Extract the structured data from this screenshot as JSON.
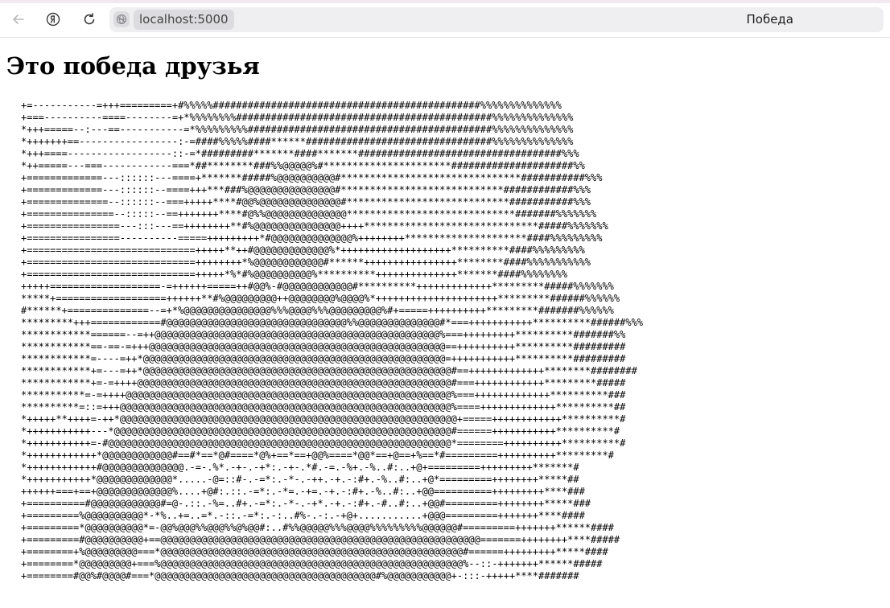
{
  "browser": {
    "url": "localhost:5000",
    "tab_title": "Победа"
  },
  "page": {
    "heading": "Это победа друзья",
    "ascii_art": "+=-----------=+++=========+#%%%%%##############################################%%%%%%%%%%%%%%\n+===----------====--------=+*%%%%%%%%############################################%%%%%%%%%%%%%%\n*+++=====--:---==-----------=*%%%%%%%%%##########################################%%%%%%%%%%%%%%\n*+++++++==-----------------:-=####%%%%%####******################################%%%%%%%%%%%%%%\n*+++====------------------::-=*#########*******####*******###################################%%%\n*++=====---===------------===*##********###%%@@@@@%#**********************#####################%%\n+=============---::::::---====+*******#####%@@@@@@@@@@#*******************************###########%%%\n+=============---::::::--====+++***###%@@@@@@@@@@@@@@@#****************************############%%%\n+==============--::::::--===+++++****#@@%@@@@@@@@@@@@@@#****************************###########%%%\n+===============--:::::--==+++++++****#@%%@@@@@@@@@@@@@@*****************************#######%%%%%%%\n+================---:::---==++++++++**#%@@@@@@@@@@@@@@@++++******************************#####%%%%%%%\n+================----------=====+++++++++*#@@@@@@@@@@@@@@%++++++++*********************####%%%%%%%%%\n+=============================+++++**++#@@@@@@@@@@@@@%*+++++++++++++++++++**********####%%%%%%%%%\n+=============================++++++++*%@@@@@@@@@@@@#******++++++++++++++++********####%%%%%%%%%%%\n+=============================+++++*%*#%@@@@@@@@@@%**********++++++++++++++*******####%%%%%%%%\n+++++===================-=++++++=====++#@@%-#@@@@@@@@@@@@#**********+++++++++++++*********#####%%%%%%%\n*****+===================++++++**#%@@@@@@@@@++@@@@@@@@%@@@@%*+++++++++++++++++++++*********######%%%%%%\n#******+==============--=+*%@@@@@@@@@@@@@@@%%%@@@@%%%@@@@@@@@@%#+=====++++++++++*********#######%%%%%%\n*********+++============#@@@@@@@@@@@@@@@@@@@@@@@@@@@@@@@%%@@@@@@@@@@@@@@#*===+++++++++++**********######%%%\n************======--=++@@@@@@@@@@@@@@@@@@@@@@@@@@@@@@@@@@@@@@@@@@@@@@@@@%===+++++++++**********#######%%\n************==-==-=+++@@@@@@@@@@@@@@@@@@@@@@@@@@@@@@@@@@@@@@@@@@@@@@@@@@@==++++++++++**********#########\n************=----=++*@@@@@@@@@@@@@@@@@@@@@@@@@@@@@@@@@@@@@@@@@@@@@@@@@@@@=+++++++++++**********#########\n************+=---=++*@@@@@@@@@@@@@@@@@@@@@@@@@@@@@@@@@@@@@@@@@@@@@@@@@@@@@#==+++++++++++++********########\n************+=-=++++@@@@@@@@@@@@@@@@@@@@@@@@@@@@@@@@@@@@@@@@@@@@@@@@@@@@@@#===++++++++++++*********#####\n***********=-=++++@@@@@@@@@@@@@@@@@@@@@@@@@@@@@@@@@@@@@@@@@@@@@@@@@@@@@@@@%===+++++++++++++**********###\n**********=::=+++@@@@@@@@@@@@@@@@@@@@@@@@@@@@@@@@@@@@@@@@@@@@@@@@@@@@@@@@@%====+++++++++++++**********##\n*+++++**++++=-++*@@@@@@@@@@@@@@@@@@@@@@@@@@@@@@@@@@@@@@@@@@@@@@@@@@@@@@@@@@+=====++++++++++++**********#\n*+++++++++++---*@@@@@@@@@@@@@@@@@@@@@@@@@@@@@@@@@@@@@@@@@@@@@@@@@@@@@@@@@@#======+++++++++++**********#\n*+++++++++++=-#@@@@@@@@@@@@@@@@@@@@@@@@@@@@@@@@@@@@@@@@@@@@@@@@@@@@@@@@@@@*========++++++++++**********#\n*++++++++++++*@@@@@@@@@@@@#==#*==*@#====*@%+==*==+@@%====*@@*==+@==+%==*#=========++++++++++*********#\n*++++++++++++#@@@@@@@@@@@@@@.-=-.%*.-+-.-+*:.-+-.*#.-=.-%+.-%..#:..+@+=========+++++++++*******#\n*+++++++++++*@@@@@@@@@@@@@*.....-@=::#-.-=*:.-*-.-++.-+.-:#+.-%..#:..+@*=========++++++++*****##\n++++++===+==+@@@@@@@@@@@@@%....+@#:.::.-=*:.-*=.-+=.-+.-:#+.-%..#:..+@@==========+++++++++****###\n+==========#@@@@@@@@@@@@#=@-.::.-%=..#+.-=*:.-*-.-+*.-+.-:#+.-#..#:..+@@#=========++++++++*****###\n+=========%@@@@@@@@@@*-*%..+=..=*.-::.-=*:.-:..#%-.-:.-+@+...........+@@@=========+++++++****####\n+=========*@@@@@@@@@@*=-@@%@@@%%@@@%%@%@@#:..#%%@@@@@%%%@@@@%%%%%%%%%@@@@@@#=========+++++++******####\n+=========#@@@@@@@@@@+==@@@@@@@@@@@@@@@@@@@@@@@@@@@@@@@@@@@@@@@@@@@@@@@@@@@@@@@=======++++++++****#####\n+========+%@@@@@@@@@===*@@@@@@@@@@@@@@@@@@@@@@@@@@@@@@@@@@@@@@@@@@@@@@@@@@@@#======+++++++++*****####\n+========*@@@@@@@@@+===%@@@@@@@@@@@@@@@@@@@@@@@@@@@@@@@@@@@@@@@@@@@@@@@@@@@@%--::-+++++++******#####\n+========#@@%#@@@@#===*@@@@@@@@@@@@@@@@@@@@@@@@@@@@@@@@@@@@@@#%@@@@@@@@@@@+-:::-+++++****#######"
  },
  "icons": {
    "back": "arrow-left-icon",
    "yandex": "yandex-logo-icon",
    "reload": "reload-icon",
    "site": "globe-slash-icon"
  }
}
